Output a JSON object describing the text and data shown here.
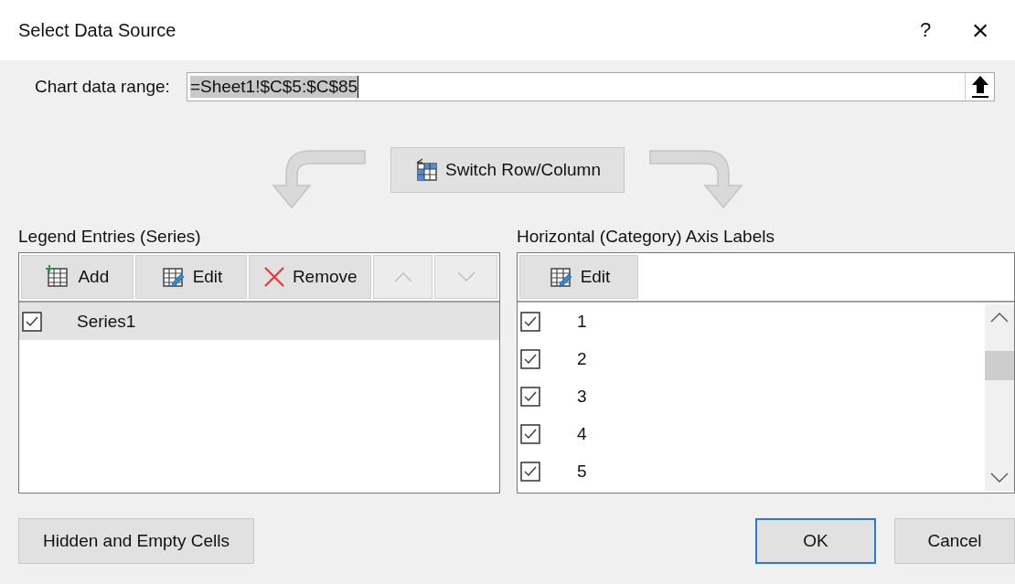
{
  "window": {
    "title": "Select Data Source",
    "help": "?",
    "close": "×"
  },
  "chart_range": {
    "label": "Chart data range:",
    "value": "=Sheet1!$C$5:$C$85"
  },
  "switch_button": "Switch Row/Column",
  "legend": {
    "label": "Legend Entries (Series)",
    "toolbar": [
      {
        "kind": "add",
        "label": "Add",
        "disabled": false
      },
      {
        "kind": "edit",
        "label": "Edit",
        "disabled": false
      },
      {
        "kind": "remove",
        "label": "Remove",
        "disabled": false
      },
      {
        "kind": "up",
        "disabled": true
      },
      {
        "kind": "down",
        "disabled": true
      }
    ],
    "items": [
      {
        "label": "Series1",
        "checked": true,
        "selected": true
      }
    ]
  },
  "axis": {
    "label": "Horizontal (Category) Axis Labels",
    "toolbar": [
      {
        "kind": "edit",
        "label": "Edit",
        "disabled": false
      }
    ],
    "items": [
      {
        "label": "1",
        "checked": true
      },
      {
        "label": "2",
        "checked": true
      },
      {
        "label": "3",
        "checked": true
      },
      {
        "label": "4",
        "checked": true
      },
      {
        "label": "5",
        "checked": true
      }
    ]
  },
  "footer": {
    "hidden_cells": "Hidden and Empty Cells",
    "buttons": [
      {
        "label": "OK",
        "default": true
      },
      {
        "label": "Cancel",
        "default": false
      }
    ]
  }
}
